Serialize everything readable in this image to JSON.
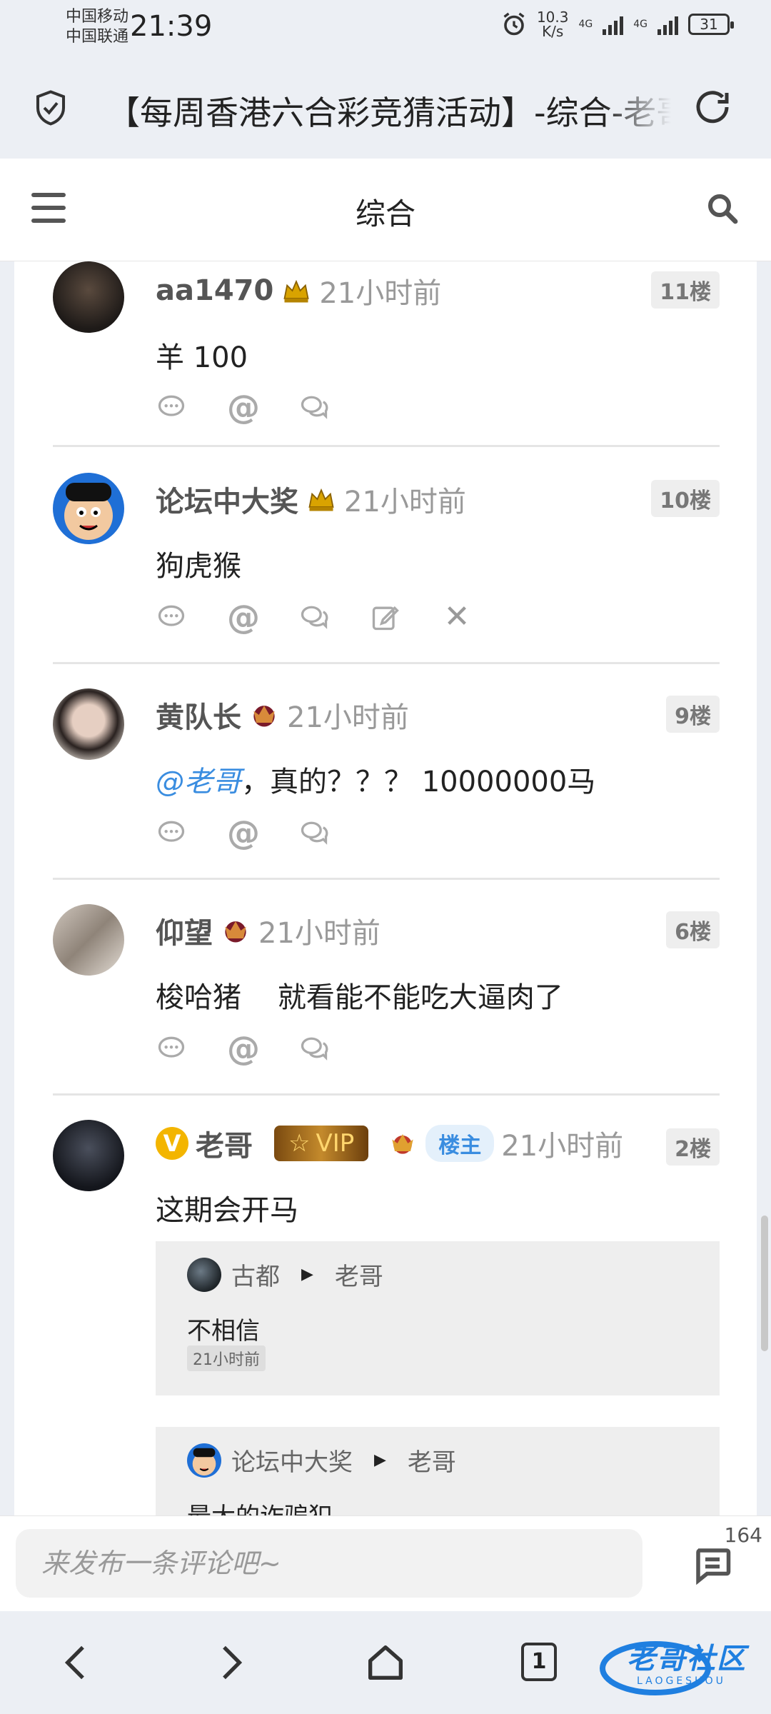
{
  "status_bar": {
    "carrier1": "中国移动",
    "carrier2": "中国联通",
    "time": "21:39",
    "net_speed_value": "10.3",
    "net_speed_unit": "K/s",
    "net_type": "4G",
    "battery": "31"
  },
  "browser": {
    "page_title": "【每周香港六合彩竞猜活动】-综合-老哥社区"
  },
  "site_header": {
    "title": "综合"
  },
  "posts": [
    {
      "username": "aa1470",
      "time": "21小时前",
      "floor": "11楼",
      "text": "羊  100"
    },
    {
      "username": "论坛中大奖",
      "time": "21小时前",
      "floor": "10楼",
      "text": "狗虎猴"
    },
    {
      "username": "黄队长",
      "time": "21小时前",
      "floor": "9楼",
      "mention": "@老哥",
      "text": "，真的？？？ 10000000马"
    },
    {
      "username": "仰望",
      "time": "21小时前",
      "floor": "6楼",
      "text": "梭哈猪    就看能不能吃大逼肉了"
    },
    {
      "username": "老哥",
      "verified_badge": "V",
      "vip_label": "VIP",
      "owner_tag": "楼主",
      "time": "21小时前",
      "floor": "2楼",
      "text": "这期会开马",
      "replies": [
        {
          "from": "古都",
          "to": "老哥",
          "text": "不相信",
          "time": "21小时前"
        },
        {
          "from": "论坛中大奖",
          "to": "老哥",
          "text": "最大的诈骗犯"
        }
      ]
    }
  ],
  "comment_bar": {
    "placeholder": "来发布一条评论吧~",
    "count": "164"
  },
  "nav_bar": {
    "tab_count": "1"
  },
  "watermark": {
    "text": "老哥社区",
    "sub": "LAOGESHOU"
  },
  "colors": {
    "accent": "#3a8de0",
    "background": "#eceff4",
    "vip_gold": "#c48a2c"
  },
  "icons": [
    "shield-check-icon",
    "reload-icon",
    "hamburger-icon",
    "search-icon",
    "comment-icon",
    "at-icon",
    "reply-icon",
    "edit-icon",
    "delete-icon",
    "crown-icon",
    "back-icon",
    "forward-icon",
    "home-icon",
    "tabs-icon"
  ]
}
